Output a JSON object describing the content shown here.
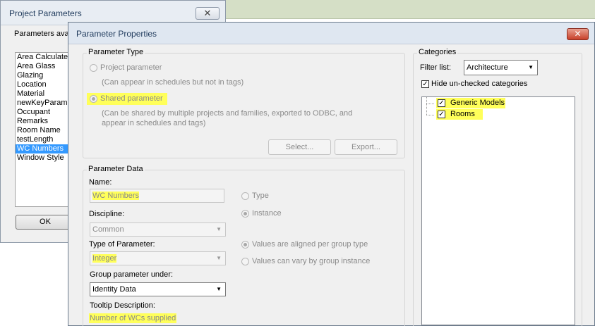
{
  "project_params": {
    "title": "Project Parameters",
    "close_glyph": "✕",
    "available_label": "Parameters ava",
    "items": [
      "Area Calculated",
      "Area Glass",
      "Glazing",
      "Location",
      "Material",
      "newKeyParam",
      "Occupant",
      "Remarks",
      "Room Name",
      "testLength",
      "WC Numbers",
      "Window Style"
    ],
    "selected_item": "WC Numbers",
    "ok_label": "OK"
  },
  "dialog": {
    "title": "Parameter Properties",
    "close_glyph": "✕",
    "parameter_type": {
      "legend": "Parameter Type",
      "project_label": "Project parameter",
      "project_desc": "(Can appear in schedules but not in tags)",
      "shared_label": "Shared parameter",
      "shared_desc_1": "(Can be shared by multiple projects and families, exported to ODBC, and",
      "shared_desc_2": "appear in schedules and tags)",
      "select_button": "Select...",
      "export_button": "Export..."
    },
    "parameter_data": {
      "legend": "Parameter Data",
      "name_label": "Name:",
      "name_value": "WC Numbers",
      "type_label": "Type",
      "instance_label": "Instance",
      "discipline_label": "Discipline:",
      "discipline_value": "Common",
      "type_of_param_label": "Type of Parameter:",
      "type_of_param_value": "Integer",
      "aligned_label": "Values are aligned per group type",
      "vary_label": "Values can vary by group instance",
      "group_label": "Group parameter under:",
      "group_value": "Identity Data",
      "tooltip_label": "Tooltip Description:",
      "tooltip_value": "Number of WCs supplied"
    },
    "categories": {
      "legend": "Categories",
      "filter_label": "Filter list:",
      "filter_value": "Architecture",
      "hide_label": "Hide un-checked categories",
      "items": [
        "Generic Models",
        "Rooms"
      ]
    }
  },
  "glyphs": {
    "dropdown": "▼",
    "check": "✓"
  },
  "colors": {
    "highlight": "#ffff5a",
    "selection": "#3399ff",
    "close_red": "#c8402a"
  }
}
